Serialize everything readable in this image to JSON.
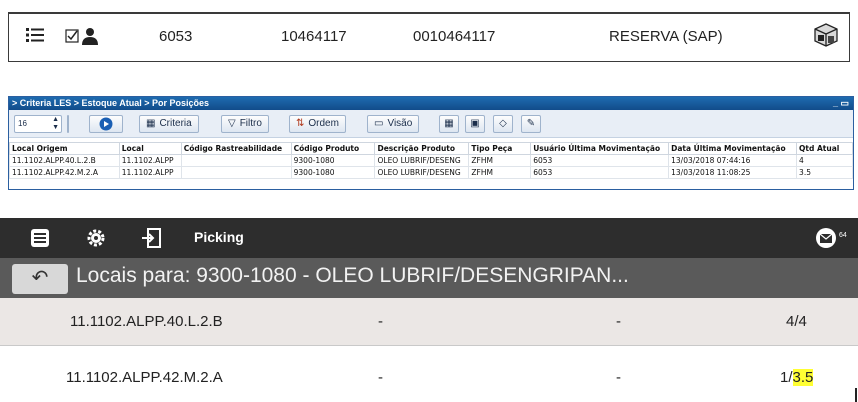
{
  "panel1": {
    "icons": [
      "list-icon",
      "checkbox-user-icon",
      "boxes-icon"
    ],
    "col1": "6053",
    "col2": "10464117",
    "col3": "0010464117",
    "col4": "RESERVA (SAP)"
  },
  "panel2": {
    "title": "> Criteria LES > Estoque Atual > Por Posições",
    "window_controls": "_ ▭",
    "page_size": "16",
    "buttons": {
      "criteria": "Criteria",
      "filtro": "Filtro",
      "ordem": "Ordem",
      "visao": "Visão"
    },
    "headers": [
      "Local Origem",
      "Local",
      "Código Rastreabilidade",
      "Código Produto",
      "Descrição Produto",
      "Tipo Peça",
      "Usuário Última Movimentação",
      "Data Última Movimentação",
      "Qtd Atual"
    ],
    "rows": [
      [
        "11.1102.ALPP.40.L.2.B",
        "11.1102.ALPP",
        "",
        "9300-1080",
        "OLEO LUBRIF/DESENG",
        "ZFHM",
        "6053",
        "13/03/2018 07:44:16",
        "4"
      ],
      [
        "11.1102.ALPP.42.M.2.A",
        "11.1102.ALPP",
        "",
        "9300-1080",
        "OLEO LUBRIF/DESENG",
        "ZFHM",
        "6053",
        "13/03/2018 11:08:25",
        "3.5"
      ]
    ]
  },
  "panel3": {
    "topbar_label": "Picking",
    "badge": "64",
    "subtitle": "Locais para: 9300-1080 - OLEO LUBRIF/DESENGRIPAN...",
    "rows": [
      {
        "location": "11.1102.ALPP.40.L.2.B",
        "a": "-",
        "b": "-",
        "qty_prefix": "4/",
        "qty_value": "4"
      },
      {
        "location": "11.1102.ALPP.42.M.2.A",
        "a": "-",
        "b": "-",
        "qty_prefix": "1/",
        "qty_value": "3.5"
      }
    ],
    "highlight_color": "#ffff33"
  }
}
